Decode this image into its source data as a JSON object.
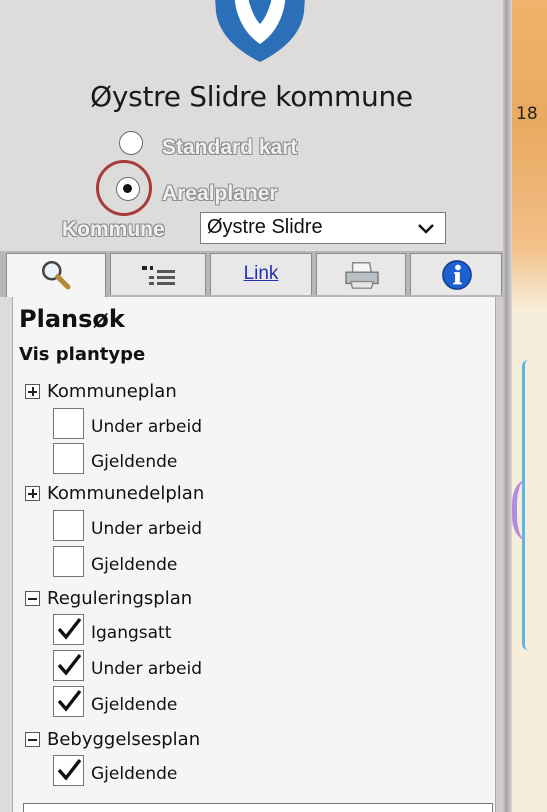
{
  "header": {
    "municipality_name": "Øystre Slidre kommune"
  },
  "map_type": {
    "options": [
      {
        "label": "Standard kart",
        "selected": false
      },
      {
        "label": "Arealplaner",
        "selected": true
      }
    ]
  },
  "kommune": {
    "label": "Kommune",
    "selected_value": "Øystre Slidre"
  },
  "tabs": [
    {
      "icon": "search-icon"
    },
    {
      "icon": "legend-icon"
    },
    {
      "label": "Link"
    },
    {
      "icon": "printer-icon"
    },
    {
      "icon": "info-icon"
    }
  ],
  "plansok": {
    "title": "Plansøk",
    "subtitle": "Vis plantype",
    "groups": [
      {
        "label": "Kommuneplan",
        "expanded": false,
        "items": [
          {
            "label": "Under arbeid",
            "checked": false
          },
          {
            "label": "Gjeldende",
            "checked": false
          }
        ]
      },
      {
        "label": "Kommunedelplan",
        "expanded": false,
        "items": [
          {
            "label": "Under arbeid",
            "checked": false
          },
          {
            "label": "Gjeldende",
            "checked": false
          }
        ]
      },
      {
        "label": "Reguleringsplan",
        "expanded": true,
        "items": [
          {
            "label": "Igangsatt",
            "checked": true
          },
          {
            "label": "Under arbeid",
            "checked": true
          },
          {
            "label": "Gjeldende",
            "checked": true
          }
        ]
      },
      {
        "label": "Bebyggelsesplan",
        "expanded": true,
        "items": [
          {
            "label": "Gjeldende",
            "checked": true
          }
        ]
      }
    ]
  },
  "map": {
    "label": "18"
  },
  "colors": {
    "panel_bg": "#dedbdb",
    "highlight_circle": "#a93b3b",
    "link": "#2233bb",
    "info_blue": "#1f5fd0",
    "logo_blue": "#2a6fb8"
  }
}
